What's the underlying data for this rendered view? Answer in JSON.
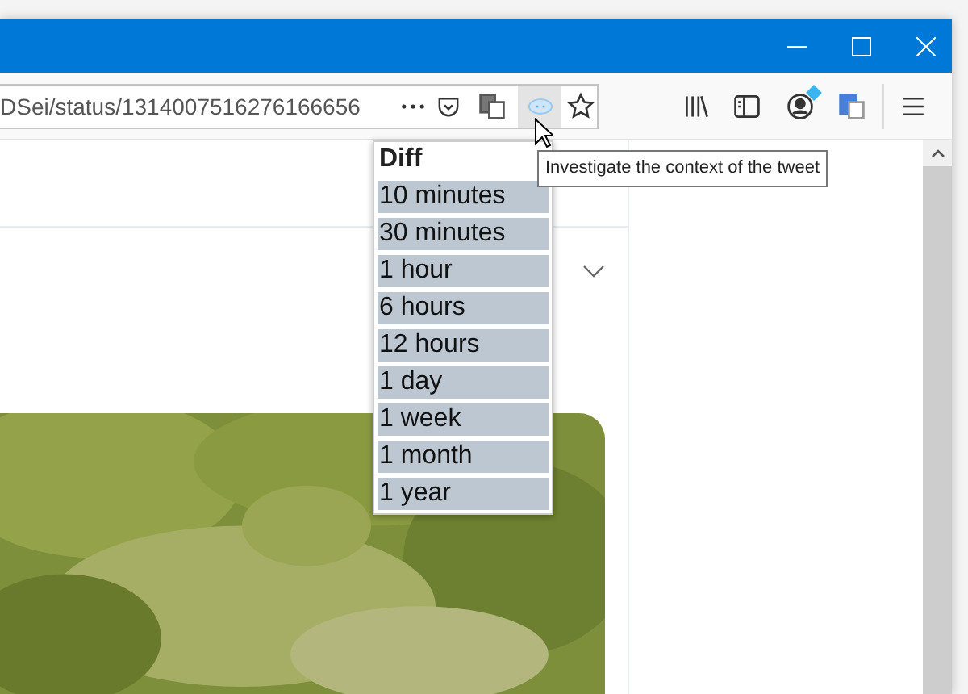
{
  "address_bar": {
    "url": "DSei/status/1314007516276166656"
  },
  "popup_menu": {
    "title": "Diff",
    "items": [
      {
        "label": "10 minutes"
      },
      {
        "label": "30 minutes"
      },
      {
        "label": "1 hour"
      },
      {
        "label": "6 hours"
      },
      {
        "label": "12 hours"
      },
      {
        "label": "1 day"
      },
      {
        "label": "1 week"
      },
      {
        "label": "1 month"
      },
      {
        "label": "1 year"
      }
    ]
  },
  "tooltip": {
    "text": "Investigate the context of the tweet"
  }
}
